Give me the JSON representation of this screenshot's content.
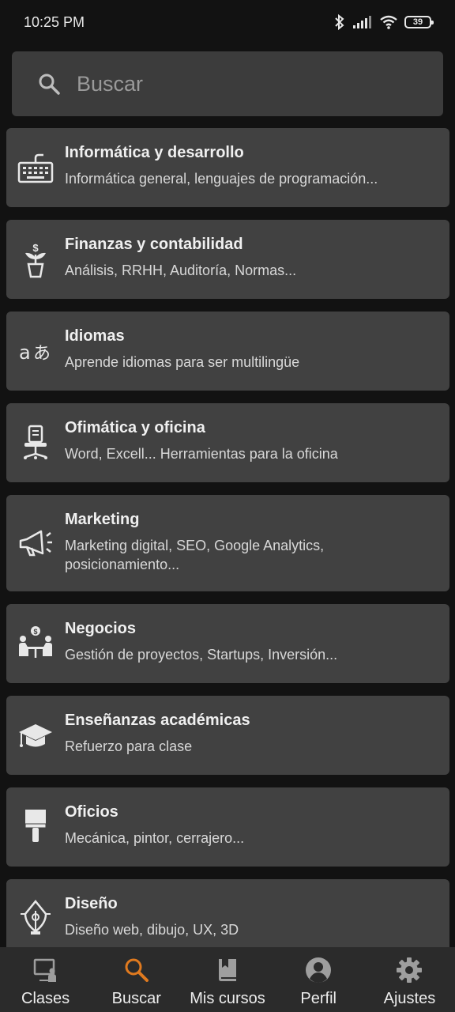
{
  "status_bar": {
    "time": "10:25 PM",
    "battery": "39"
  },
  "search": {
    "placeholder": "Buscar"
  },
  "categories": [
    {
      "title": "Informática y desarrollo",
      "subtitle": "Informática general, lenguajes de programación...",
      "icon": "keyboard-icon"
    },
    {
      "title": "Finanzas y contabilidad",
      "subtitle": "Análisis, RRHH, Auditoría, Normas...",
      "icon": "money-plant-icon"
    },
    {
      "title": "Idiomas",
      "subtitle": "Aprende idiomas para ser multilingüe",
      "icon": "translate-icon"
    },
    {
      "title": "Ofimática y oficina",
      "subtitle": "Word, Excell... Herramientas para la oficina",
      "icon": "office-chair-icon"
    },
    {
      "title": "Marketing",
      "subtitle": "Marketing digital, SEO, Google Analytics, posicionamiento...",
      "icon": "megaphone-icon"
    },
    {
      "title": "Negocios",
      "subtitle": "Gestión de proyectos, Startups, Inversión...",
      "icon": "business-meeting-icon"
    },
    {
      "title": "Enseñanzas académicas",
      "subtitle": "Refuerzo para clase",
      "icon": "graduation-cap-icon"
    },
    {
      "title": "Oficios",
      "subtitle": "Mecánica, pintor, cerrajero...",
      "icon": "paint-brush-icon"
    },
    {
      "title": "Diseño",
      "subtitle": "Diseño web, dibujo, UX, 3D",
      "icon": "pen-nib-icon"
    }
  ],
  "bottom_nav": [
    {
      "label": "Clases",
      "icon": "teacher-board-icon",
      "active": false
    },
    {
      "label": "Buscar",
      "icon": "search-icon",
      "active": true
    },
    {
      "label": "Mis cursos",
      "icon": "book-icon",
      "active": false
    },
    {
      "label": "Perfil",
      "icon": "account-icon",
      "active": false
    },
    {
      "label": "Ajustes",
      "icon": "gear-icon",
      "active": false
    }
  ],
  "colors": {
    "background": "#121212",
    "card": "#414141",
    "search_bg": "#3c3c3c",
    "nav_bg": "#2b2b2b",
    "accent": "#e07a1f"
  }
}
